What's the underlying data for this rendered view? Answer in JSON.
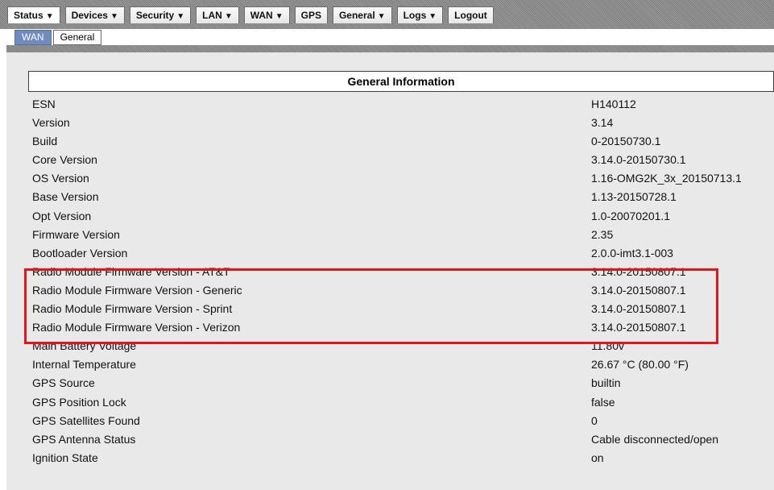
{
  "nav": {
    "menu": [
      {
        "label": "Status",
        "dropdown": true,
        "active": true
      },
      {
        "label": "Devices",
        "dropdown": true
      },
      {
        "label": "Security",
        "dropdown": true
      },
      {
        "label": "LAN",
        "dropdown": true
      },
      {
        "label": "WAN",
        "dropdown": true
      },
      {
        "label": "GPS",
        "dropdown": false
      },
      {
        "label": "General",
        "dropdown": true
      },
      {
        "label": "Logs",
        "dropdown": true
      },
      {
        "label": "Logout",
        "dropdown": false
      }
    ],
    "dropdown_arrow": "▼",
    "subtabs": [
      {
        "label": "WAN",
        "active": true
      },
      {
        "label": "General",
        "active": false
      }
    ]
  },
  "info": {
    "header": "General Information",
    "rows": [
      {
        "label": "ESN",
        "value": "H140112"
      },
      {
        "label": "Version",
        "value": "3.14"
      },
      {
        "label": "Build",
        "value": "0-20150730.1"
      },
      {
        "label": "Core Version",
        "value": "3.14.0-20150730.1"
      },
      {
        "label": "OS Version",
        "value": "1.16-OMG2K_3x_20150713.1"
      },
      {
        "label": "Base Version",
        "value": "1.13-20150728.1"
      },
      {
        "label": "Opt Version",
        "value": "1.0-20070201.1"
      },
      {
        "label": "Firmware Version",
        "value": "2.35"
      },
      {
        "label": "Bootloader Version",
        "value": "2.0.0-imt3.1-003"
      },
      {
        "label": "Radio Module Firmware Version - AT&T",
        "value": "3.14.0-20150807.1"
      },
      {
        "label": "Radio Module Firmware Version - Generic",
        "value": "3.14.0-20150807.1"
      },
      {
        "label": "Radio Module Firmware Version - Sprint",
        "value": "3.14.0-20150807.1"
      },
      {
        "label": "Radio Module Firmware Version - Verizon",
        "value": "3.14.0-20150807.1"
      },
      {
        "label": "Main Battery Voltage",
        "value": "11.80v"
      },
      {
        "label": "Internal Temperature",
        "value": "26.67 °C (80.00 °F)"
      },
      {
        "label": "GPS Source",
        "value": "builtin"
      },
      {
        "label": "GPS Position Lock",
        "value": "false"
      },
      {
        "label": "GPS Satellites Found",
        "value": "0"
      },
      {
        "label": "GPS Antenna Status",
        "value": "Cable disconnected/open"
      },
      {
        "label": "Ignition State",
        "value": "on"
      }
    ]
  },
  "colors": {
    "highlight_border": "#e2141c",
    "active_subtab": "#6f8bbf",
    "panel_background": "#e9e9e9"
  }
}
